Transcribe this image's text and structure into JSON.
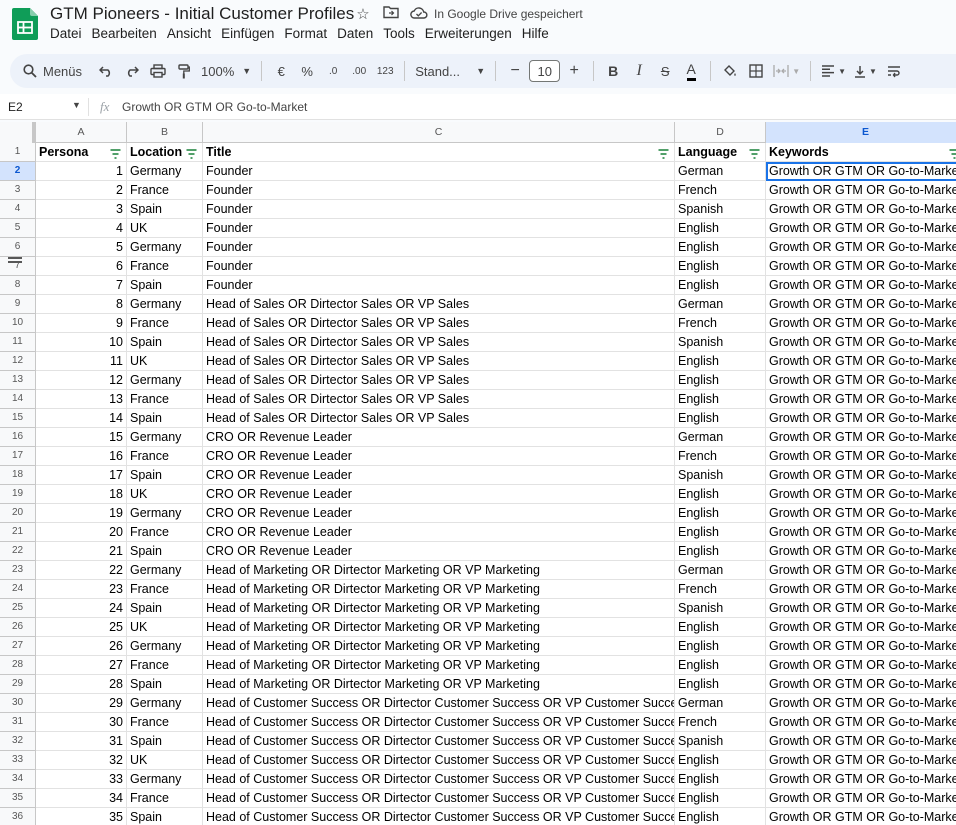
{
  "app": {
    "title": "GTM Pioneers - Initial Customer Profiles",
    "saved_status": "In Google Drive gespeichert",
    "icons": [
      "star-icon",
      "move-to-folder-icon",
      "cloud-saved-icon"
    ]
  },
  "menu": [
    "Datei",
    "Bearbeiten",
    "Ansicht",
    "Einfügen",
    "Format",
    "Daten",
    "Tools",
    "Erweiterungen",
    "Hilfe"
  ],
  "toolbar": {
    "search_label": "Menüs",
    "zoom": "100%",
    "currency": "€",
    "percent": "%",
    "decrease_decimals": ".0",
    "increase_decimals": ".00",
    "number_format": "123",
    "font_family": "Stand...",
    "font_size": "10",
    "minus": "−",
    "plus": "+",
    "bold": "B",
    "italic": "I",
    "strikethrough": "S",
    "text_color": "A"
  },
  "formula_bar": {
    "cell_ref": "E2",
    "fx": "fx",
    "content": "Growth OR GTM OR Go-to-Market"
  },
  "columns": [
    {
      "letter": "A",
      "header": "Persona"
    },
    {
      "letter": "B",
      "header": "Location"
    },
    {
      "letter": "C",
      "header": "Title"
    },
    {
      "letter": "D",
      "header": "Language"
    },
    {
      "letter": "E",
      "header": "Keywords"
    }
  ],
  "selected_cell": {
    "row": 2,
    "col": "E"
  },
  "rows": [
    [
      "1",
      "Germany",
      "Founder",
      "German",
      "Growth OR GTM OR Go-to-Market"
    ],
    [
      "2",
      "France",
      "Founder",
      "French",
      "Growth OR GTM OR Go-to-Market"
    ],
    [
      "3",
      "Spain",
      "Founder",
      "Spanish",
      "Growth OR GTM OR Go-to-Market"
    ],
    [
      "4",
      "UK",
      "Founder",
      "English",
      "Growth OR GTM OR Go-to-Market"
    ],
    [
      "5",
      "Germany",
      "Founder",
      "English",
      "Growth OR GTM OR Go-to-Market"
    ],
    [
      "6",
      "France",
      "Founder",
      "English",
      "Growth OR GTM OR Go-to-Market"
    ],
    [
      "7",
      "Spain",
      "Founder",
      "English",
      "Growth OR GTM OR Go-to-Market"
    ],
    [
      "8",
      "Germany",
      "Head of Sales OR Dirtector Sales OR VP Sales",
      "German",
      "Growth OR GTM OR Go-to-Market"
    ],
    [
      "9",
      "France",
      "Head of Sales OR Dirtector Sales OR VP Sales",
      "French",
      "Growth OR GTM OR Go-to-Market"
    ],
    [
      "10",
      "Spain",
      "Head of Sales OR Dirtector Sales OR VP Sales",
      "Spanish",
      "Growth OR GTM OR Go-to-Market"
    ],
    [
      "11",
      "UK",
      "Head of Sales OR Dirtector Sales OR VP Sales",
      "English",
      "Growth OR GTM OR Go-to-Market"
    ],
    [
      "12",
      "Germany",
      "Head of Sales OR Dirtector Sales OR VP Sales",
      "English",
      "Growth OR GTM OR Go-to-Market"
    ],
    [
      "13",
      "France",
      "Head of Sales OR Dirtector Sales OR VP Sales",
      "English",
      "Growth OR GTM OR Go-to-Market"
    ],
    [
      "14",
      "Spain",
      "Head of Sales OR Dirtector Sales OR VP Sales",
      "English",
      "Growth OR GTM OR Go-to-Market"
    ],
    [
      "15",
      "Germany",
      "CRO OR Revenue Leader",
      "German",
      "Growth OR GTM OR Go-to-Market"
    ],
    [
      "16",
      "France",
      "CRO OR Revenue Leader",
      "French",
      "Growth OR GTM OR Go-to-Market"
    ],
    [
      "17",
      "Spain",
      "CRO OR Revenue Leader",
      "Spanish",
      "Growth OR GTM OR Go-to-Market"
    ],
    [
      "18",
      "UK",
      "CRO OR Revenue Leader",
      "English",
      "Growth OR GTM OR Go-to-Market"
    ],
    [
      "19",
      "Germany",
      "CRO OR Revenue Leader",
      "English",
      "Growth OR GTM OR Go-to-Market"
    ],
    [
      "20",
      "France",
      "CRO OR Revenue Leader",
      "English",
      "Growth OR GTM OR Go-to-Market"
    ],
    [
      "21",
      "Spain",
      "CRO OR Revenue Leader",
      "English",
      "Growth OR GTM OR Go-to-Market"
    ],
    [
      "22",
      "Germany",
      "Head of Marketing OR Dirtector Marketing OR VP Marketing",
      "German",
      "Growth OR GTM OR Go-to-Market"
    ],
    [
      "23",
      "France",
      "Head of Marketing OR Dirtector Marketing OR VP Marketing",
      "French",
      "Growth OR GTM OR Go-to-Market"
    ],
    [
      "24",
      "Spain",
      "Head of Marketing OR Dirtector Marketing OR VP Marketing",
      "Spanish",
      "Growth OR GTM OR Go-to-Market"
    ],
    [
      "25",
      "UK",
      "Head of Marketing OR Dirtector Marketing OR VP Marketing",
      "English",
      "Growth OR GTM OR Go-to-Market"
    ],
    [
      "26",
      "Germany",
      "Head of Marketing OR Dirtector Marketing OR VP Marketing",
      "English",
      "Growth OR GTM OR Go-to-Market"
    ],
    [
      "27",
      "France",
      "Head of Marketing OR Dirtector Marketing OR VP Marketing",
      "English",
      "Growth OR GTM OR Go-to-Market"
    ],
    [
      "28",
      "Spain",
      "Head of Marketing OR Dirtector Marketing OR VP Marketing",
      "English",
      "Growth OR GTM OR Go-to-Market"
    ],
    [
      "29",
      "Germany",
      "Head of Customer Success OR Dirtector Customer Success OR VP Customer Success",
      "German",
      "Growth OR GTM OR Go-to-Market"
    ],
    [
      "30",
      "France",
      "Head of Customer Success OR Dirtector Customer Success OR VP Customer Success",
      "French",
      "Growth OR GTM OR Go-to-Market"
    ],
    [
      "31",
      "Spain",
      "Head of Customer Success OR Dirtector Customer Success OR VP Customer Success",
      "Spanish",
      "Growth OR GTM OR Go-to-Market"
    ],
    [
      "32",
      "UK",
      "Head of Customer Success OR Dirtector Customer Success OR VP Customer Success",
      "English",
      "Growth OR GTM OR Go-to-Market"
    ],
    [
      "33",
      "Germany",
      "Head of Customer Success OR Dirtector Customer Success OR VP Customer Success",
      "English",
      "Growth OR GTM OR Go-to-Market"
    ],
    [
      "34",
      "France",
      "Head of Customer Success OR Dirtector Customer Success OR VP Customer Success",
      "English",
      "Growth OR GTM OR Go-to-Market"
    ],
    [
      "35",
      "Spain",
      "Head of Customer Success OR Dirtector Customer Success OR VP Customer Success",
      "English",
      "Growth OR GTM OR Go-to-Market"
    ]
  ],
  "colors": {
    "selection": "#1a73e8",
    "header_selected_bg": "#d3e3fd",
    "sheets_green": "#0f9d58"
  }
}
